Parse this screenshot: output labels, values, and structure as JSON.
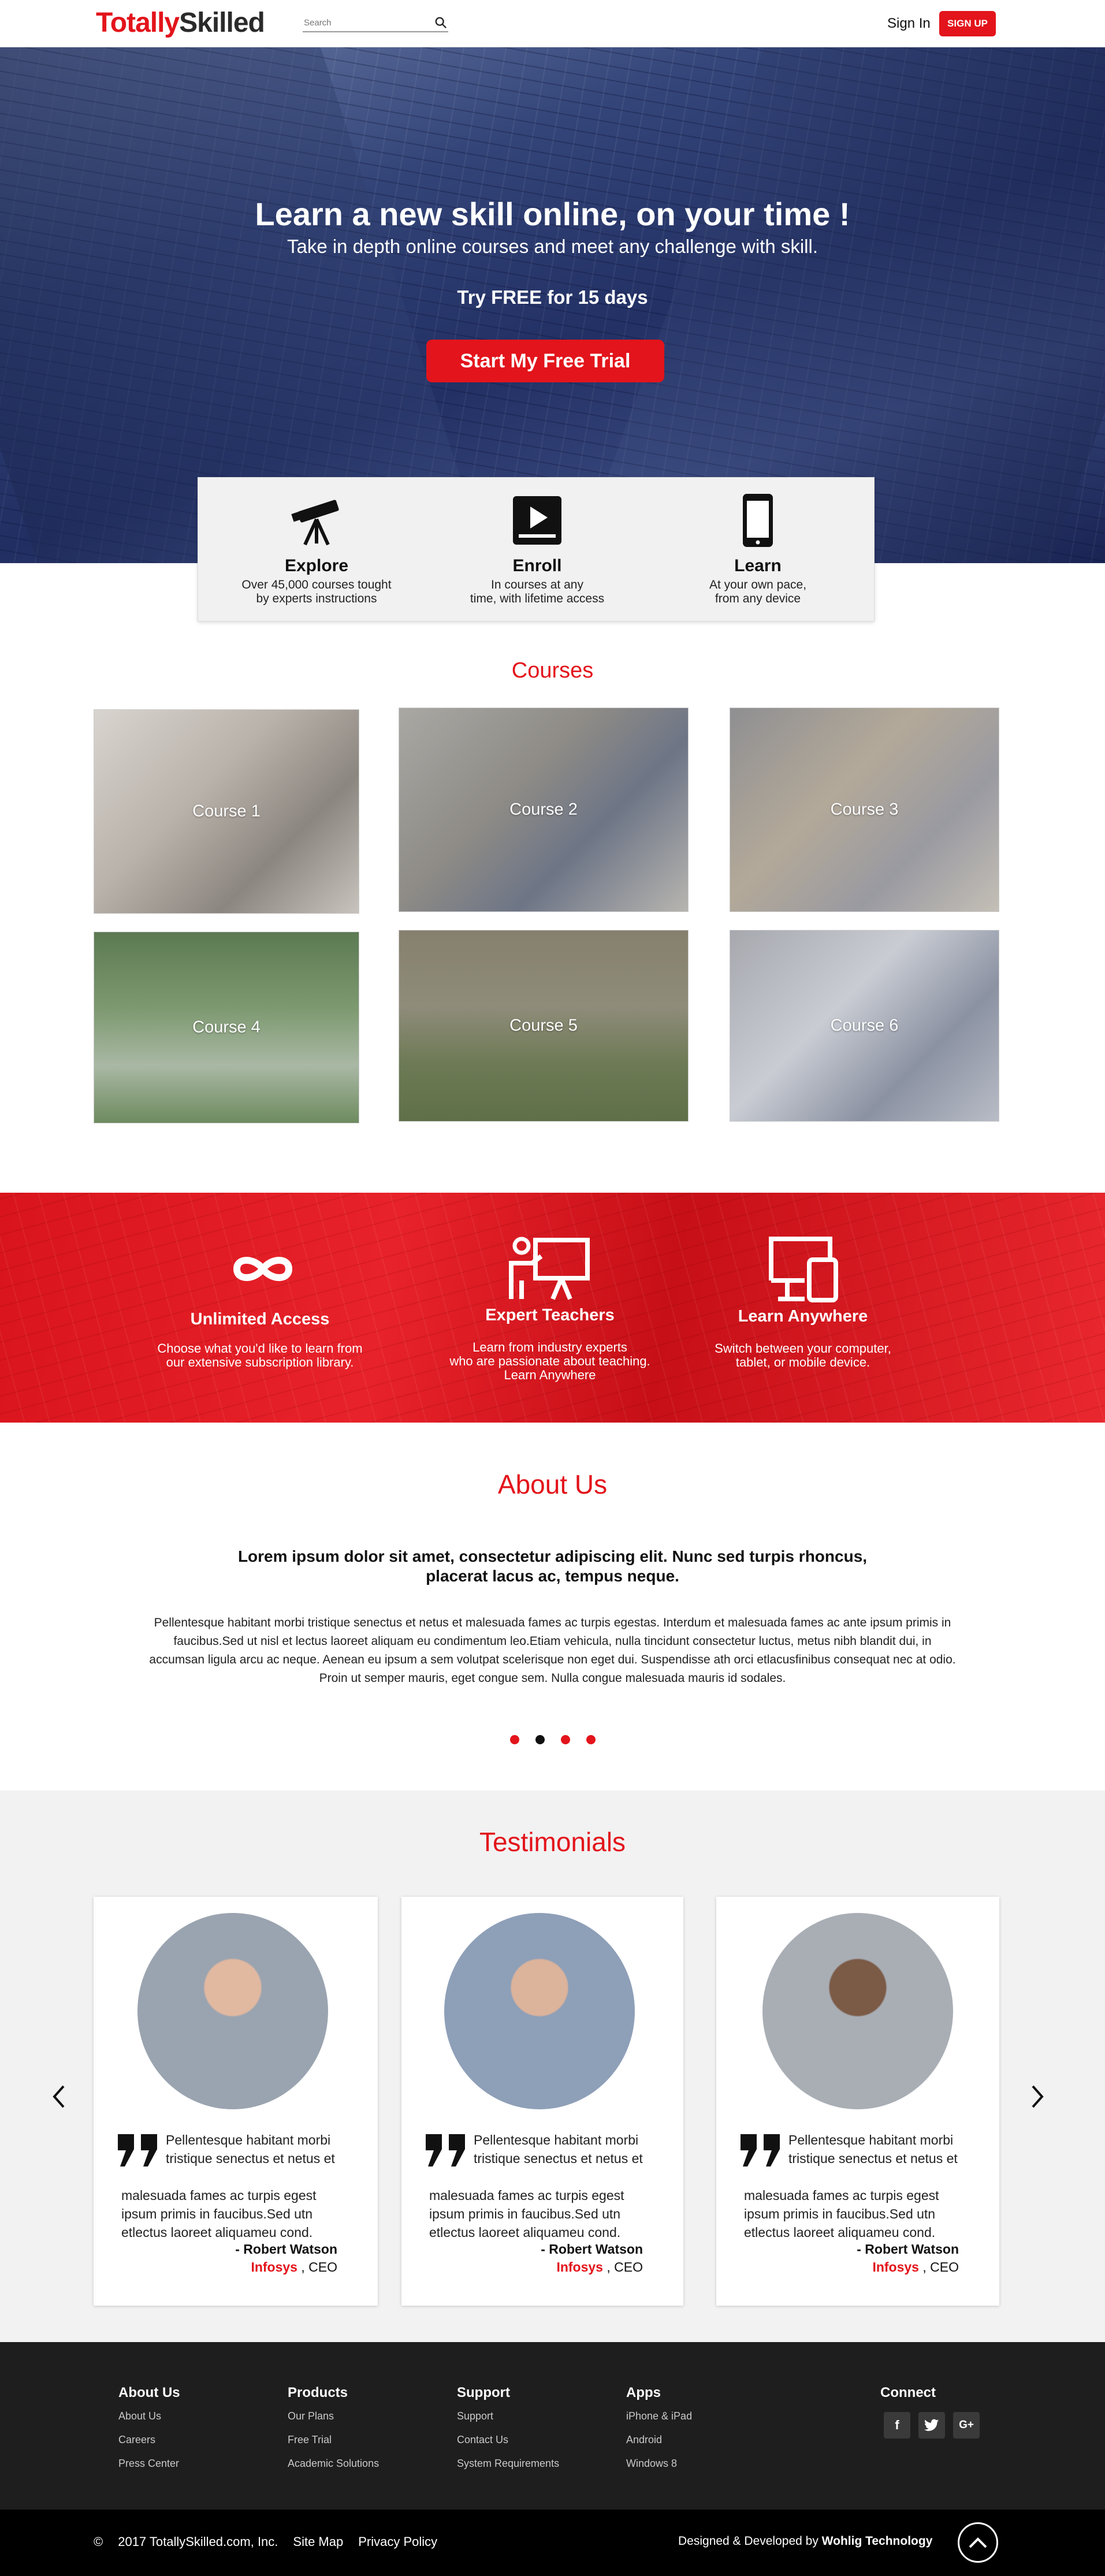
{
  "header": {
    "logo_part1": "Totally",
    "logo_part2": "Skilled",
    "search_placeholder": "Search",
    "signin": "Sign In",
    "signup": "SIGN UP"
  },
  "hero": {
    "title": "Learn a new skill online, on your time !",
    "subtitle": "Take in depth  online courses and meet any challenge with skill.",
    "trial_text": "Try  FREE  for 15 days",
    "cta": "Start My Free Trial"
  },
  "features": [
    {
      "icon": "telescope-icon",
      "title": "Explore",
      "desc1": "Over 45,000 courses tought",
      "desc2": "by experts instructions"
    },
    {
      "icon": "video-play-icon",
      "title": "Enroll",
      "desc1": "In courses at any",
      "desc2": "time, with lifetime access"
    },
    {
      "icon": "smartphone-icon",
      "title": "Learn",
      "desc1": "At your own pace,",
      "desc2": "from any device"
    }
  ],
  "courses": {
    "title": "Courses",
    "items": [
      "Course 1",
      "Course 2",
      "Course 3",
      "Course 4",
      "Course 5",
      "Course 6"
    ]
  },
  "benefits": [
    {
      "icon": "infinity-icon",
      "title": "Unlimited Access",
      "desc1": "Choose what you'd like to learn from",
      "desc2": "our extensive subscription library.",
      "desc3": ""
    },
    {
      "icon": "teacher-board-icon",
      "title": "Expert Teachers",
      "desc1": "Learn from industry experts",
      "desc2": "who are passionate about teaching.",
      "desc3": "Learn Anywhere"
    },
    {
      "icon": "devices-icon",
      "title": "Learn Anywhere",
      "desc1": "Switch between your computer,",
      "desc2": "tablet, or mobile device.",
      "desc3": ""
    }
  ],
  "about": {
    "title": "About Us",
    "lead": "Lorem ipsum dolor sit amet, consectetur adipiscing elit. Nunc sed turpis rhoncus, placerat lacus ac, tempus neque.",
    "body": "Pellentesque habitant morbi tristique senectus et netus et malesuada fames ac turpis egestas. Interdum et malesuada fames ac ante ipsum primis in faucibus.Sed ut nisl et lectus laoreet aliquam eu condimentum leo.Etiam vehicula, nulla tincidunt  consectetur luctus, metus nibh blandit dui, in accumsan ligula arcu ac neque. Aenean eu ipsum a sem volutpat scelerisque non eget dui. Suspendisse ath orci etlacusfinibus consequat nec at odio. Proin ut semper mauris, eget congue sem. Nulla congue malesuada mauris id sodales."
  },
  "testimonials": {
    "title": "Testimonials",
    "items": [
      {
        "line1": "Pellentesque habitant morbi",
        "line2": "tristique senectus et netus et",
        "line3": "malesuada fames ac turpis egest",
        "line4": "ipsum primis in faucibus.Sed utn",
        "line5": "etlectus laoreet aliquameu cond.",
        "name": "- Robert Watson",
        "company": "Infosys",
        "role": " , CEO"
      },
      {
        "line1": "Pellentesque habitant morbi",
        "line2": "tristique senectus et netus et",
        "line3": "malesuada fames ac turpis egest",
        "line4": "ipsum primis in faucibus.Sed utn",
        "line5": "etlectus laoreet aliquameu cond.",
        "name": "- Robert Watson",
        "company": "Infosys",
        "role": " , CEO"
      },
      {
        "line1": "Pellentesque habitant morbi",
        "line2": "tristique senectus et netus et",
        "line3": "malesuada fames ac turpis egest",
        "line4": "ipsum primis in faucibus.Sed utn",
        "line5": "etlectus laoreet aliquameu cond.",
        "name": "- Robert Watson",
        "company": "Infosys",
        "role": " , CEO"
      }
    ]
  },
  "footer": {
    "columns": [
      {
        "heading": "About Us",
        "links": [
          "About Us",
          "Careers",
          "Press Center"
        ]
      },
      {
        "heading": "Products",
        "links": [
          "Our Plans",
          "Free Trial",
          "Academic Solutions"
        ]
      },
      {
        "heading": "Support",
        "links": [
          "Support",
          "Contact Us",
          "System Requirements"
        ]
      },
      {
        "heading": "Apps",
        "links": [
          "iPhone & iPad",
          "Android",
          "Windows 8"
        ]
      }
    ],
    "connect": "Connect",
    "social": [
      "f",
      "twitter-icon",
      "G+"
    ],
    "copyright": "2017  TotallySkilled.com, Inc.",
    "sitemap": "Site Map",
    "privacy": "Privacy Policy",
    "designed_prefix": "Designed & Developed by ",
    "designed_by": "Wohlig Technology"
  },
  "colors": {
    "accent": "#e3141b",
    "footer": "#1e1e1e",
    "testimonial_bg": "#f2f2f2"
  }
}
